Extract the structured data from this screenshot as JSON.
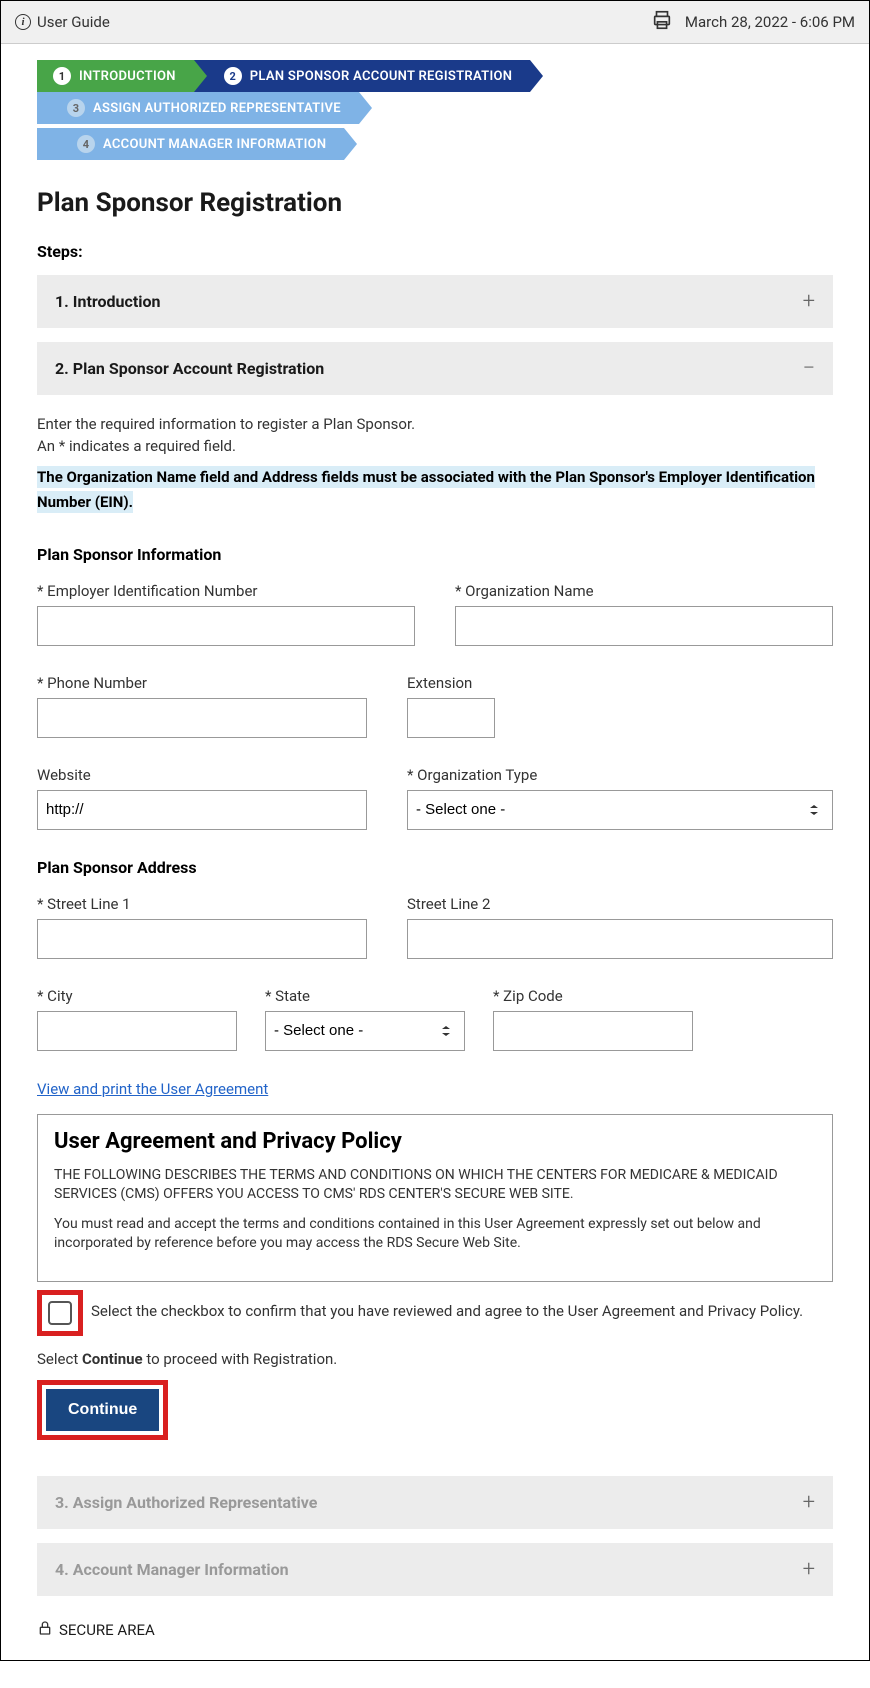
{
  "header": {
    "user_guide": "User Guide",
    "datetime": "March 28, 2022 - 6:06 PM"
  },
  "progress": {
    "s1": "INTRODUCTION",
    "s2": "PLAN SPONSOR ACCOUNT REGISTRATION",
    "s3": "ASSIGN AUTHORIZED REPRESENTATIVE",
    "s4": "ACCOUNT MANAGER INFORMATION"
  },
  "title": "Plan Sponsor Registration",
  "steps_label": "Steps:",
  "accordion": {
    "a1": "1. Introduction",
    "a2": "2. Plan Sponsor Account Registration",
    "a3": "3. Assign Authorized Representative",
    "a4": "4. Account Manager Information"
  },
  "intro": {
    "l1": "Enter the required information to register a Plan Sponsor.",
    "l2": "An * indicates a required field.",
    "hl": "The Organization Name field and Address fields must be associated with the Plan Sponsor's Employer Identification Number (EIN)."
  },
  "section": {
    "info": "Plan Sponsor Information",
    "address": "Plan Sponsor Address"
  },
  "labels": {
    "ein": "* Employer Identification Number",
    "org": "* Organization Name",
    "phone": "* Phone Number",
    "ext": "Extension",
    "website": "Website",
    "orgtype": "* Organization Type",
    "street1": "* Street Line 1",
    "street2": "Street Line 2",
    "city": "* City",
    "state": "* State",
    "zip": "* Zip Code"
  },
  "values": {
    "website": "http://",
    "orgtype_placeholder": "- Select one -",
    "state_placeholder": "- Select one -"
  },
  "link_text": "View and print the User Agreement",
  "agreement": {
    "title": "User Agreement and Privacy Policy",
    "p1": "THE FOLLOWING DESCRIBES THE TERMS AND CONDITIONS ON WHICH THE CENTERS FOR MEDICARE & MEDICAID SERVICES (CMS) OFFERS YOU ACCESS TO CMS' RDS CENTER'S SECURE WEB SITE.",
    "p2": "You must read and accept the terms and conditions contained in this User Agreement expressly set out below and incorporated by reference before you may access the RDS Secure Web Site."
  },
  "checkbox_text": "Select the checkbox to confirm that you have reviewed and agree to the User Agreement and Privacy Policy.",
  "continue_text_pre": "Select ",
  "continue_text_bold": "Continue",
  "continue_text_post": " to proceed with Registration.",
  "continue_btn": "Continue",
  "secure": "SECURE AREA"
}
